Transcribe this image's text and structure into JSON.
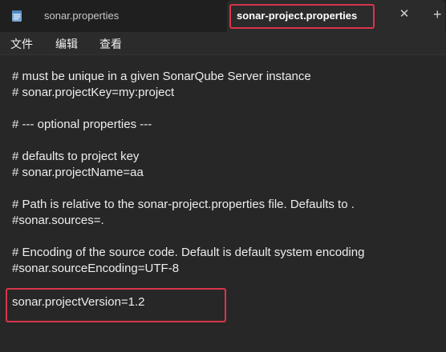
{
  "tabs": [
    {
      "label": "sonar.properties",
      "active": false,
      "icon": "notepad-file-icon"
    },
    {
      "label": "sonar-project.properties",
      "active": true
    }
  ],
  "menu": [
    "文件",
    "编辑",
    "查看"
  ],
  "editor": {
    "lines": [
      "# must be unique in a given SonarQube Server instance",
      "# sonar.projectKey=my:project",
      "",
      "# --- optional properties ---",
      "",
      "# defaults to project key",
      "# sonar.projectName=aa",
      "",
      "# Path is relative to the sonar-project.properties file. Defaults to .",
      "#sonar.sources=.",
      "",
      "# Encoding of the source code. Default is default system encoding",
      "#sonar.sourceEncoding=UTF-8",
      "",
      "sonar.projectVersion=1.2"
    ]
  },
  "colors": {
    "highlight": "#d9364b",
    "background": "#272727",
    "tabbar": "#1f1f1f"
  }
}
